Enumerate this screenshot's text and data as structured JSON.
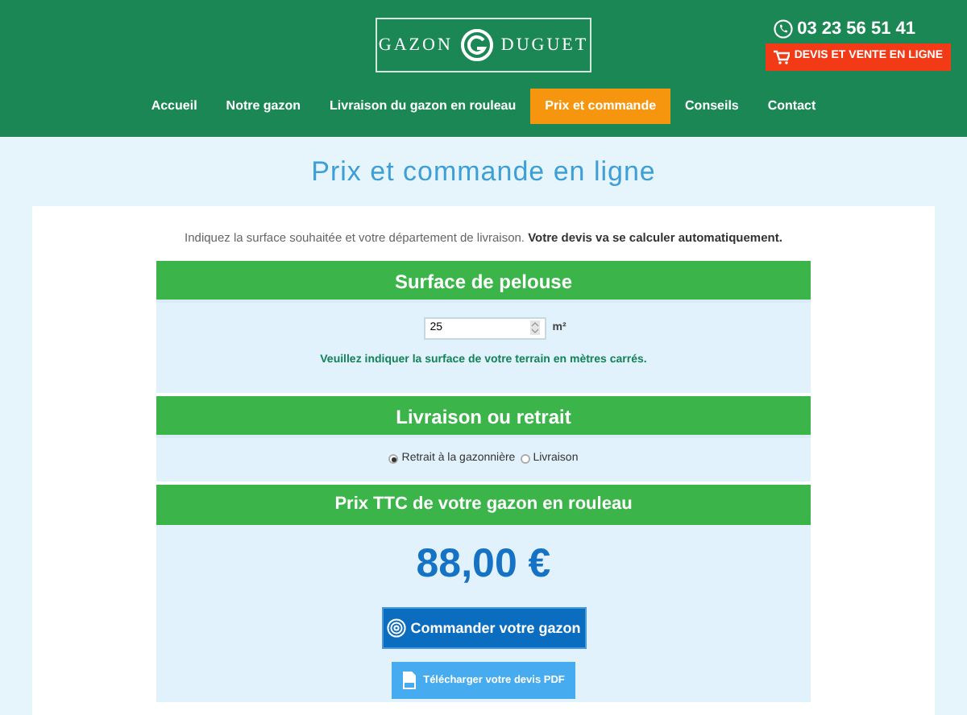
{
  "header": {
    "logo": {
      "left": "GAZON",
      "right": "DUGUET"
    },
    "phone": "03 23 56 51 41",
    "cta": "DEVIS ET VENTE EN LIGNE"
  },
  "nav": [
    {
      "label": "Accueil",
      "selected": false
    },
    {
      "label": "Notre gazon",
      "selected": false
    },
    {
      "label": "Livraison du gazon en rouleau",
      "selected": false
    },
    {
      "label": "Prix et commande",
      "selected": true
    },
    {
      "label": "Conseils",
      "selected": false
    },
    {
      "label": "Contact",
      "selected": false
    }
  ],
  "page_title": "Prix et commande en ligne",
  "intro": "Indiquez la surface souhaitée et votre département de livraison. **Votre devis va se calculer automatiquement.**",
  "surface": {
    "heading": "Surface de pelouse",
    "value": "25",
    "unit": "m²",
    "hint": "Veuillez indiquer la surface de votre terrain en mètres carrés."
  },
  "delivery": {
    "heading": "Livraison ou retrait",
    "options": [
      {
        "label": "Retrait à la gazonnière",
        "selected": true
      },
      {
        "label": "Livraison",
        "selected": false
      }
    ]
  },
  "price": {
    "heading": "Prix TTC de votre gazon en rouleau",
    "amount": "88,00 €",
    "order_button": "Commander votre gazon",
    "pdf_button": "Télécharger votre devis PDF"
  }
}
